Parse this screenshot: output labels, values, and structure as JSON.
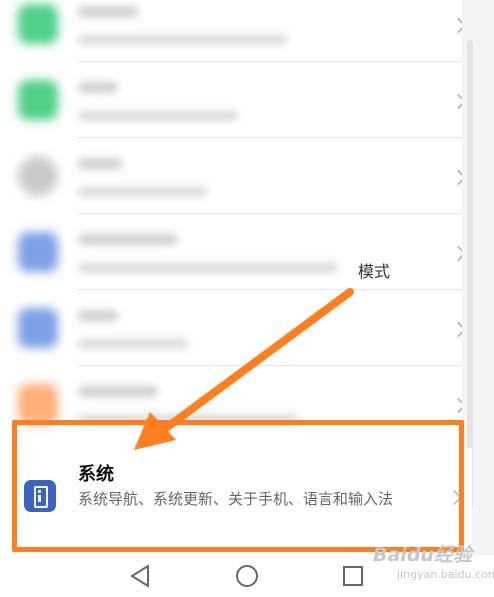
{
  "blurred_rows": [
    {
      "icon_color": "#4fd08a"
    },
    {
      "icon_color": "#50cf86"
    },
    {
      "icon_color": "#c9c9c9"
    },
    {
      "icon_color": "#7ea0e6"
    },
    {
      "icon_color": "#7ea0e6"
    },
    {
      "icon_color": "#ffae78"
    }
  ],
  "partial_text": "模式",
  "system_item": {
    "title": "系统",
    "subtitle": "系统导航、系统更新、关于手机、语言和输入法",
    "icon": "system-info-icon"
  },
  "annotation": {
    "color": "#ff7f1e"
  },
  "navbar": {
    "back_icon": "triangle-back-icon",
    "home_icon": "circle-home-icon",
    "recent_icon": "square-recent-icon"
  },
  "watermark": {
    "main": "Baidu经验",
    "sub": "jingyan.baidu.com"
  }
}
